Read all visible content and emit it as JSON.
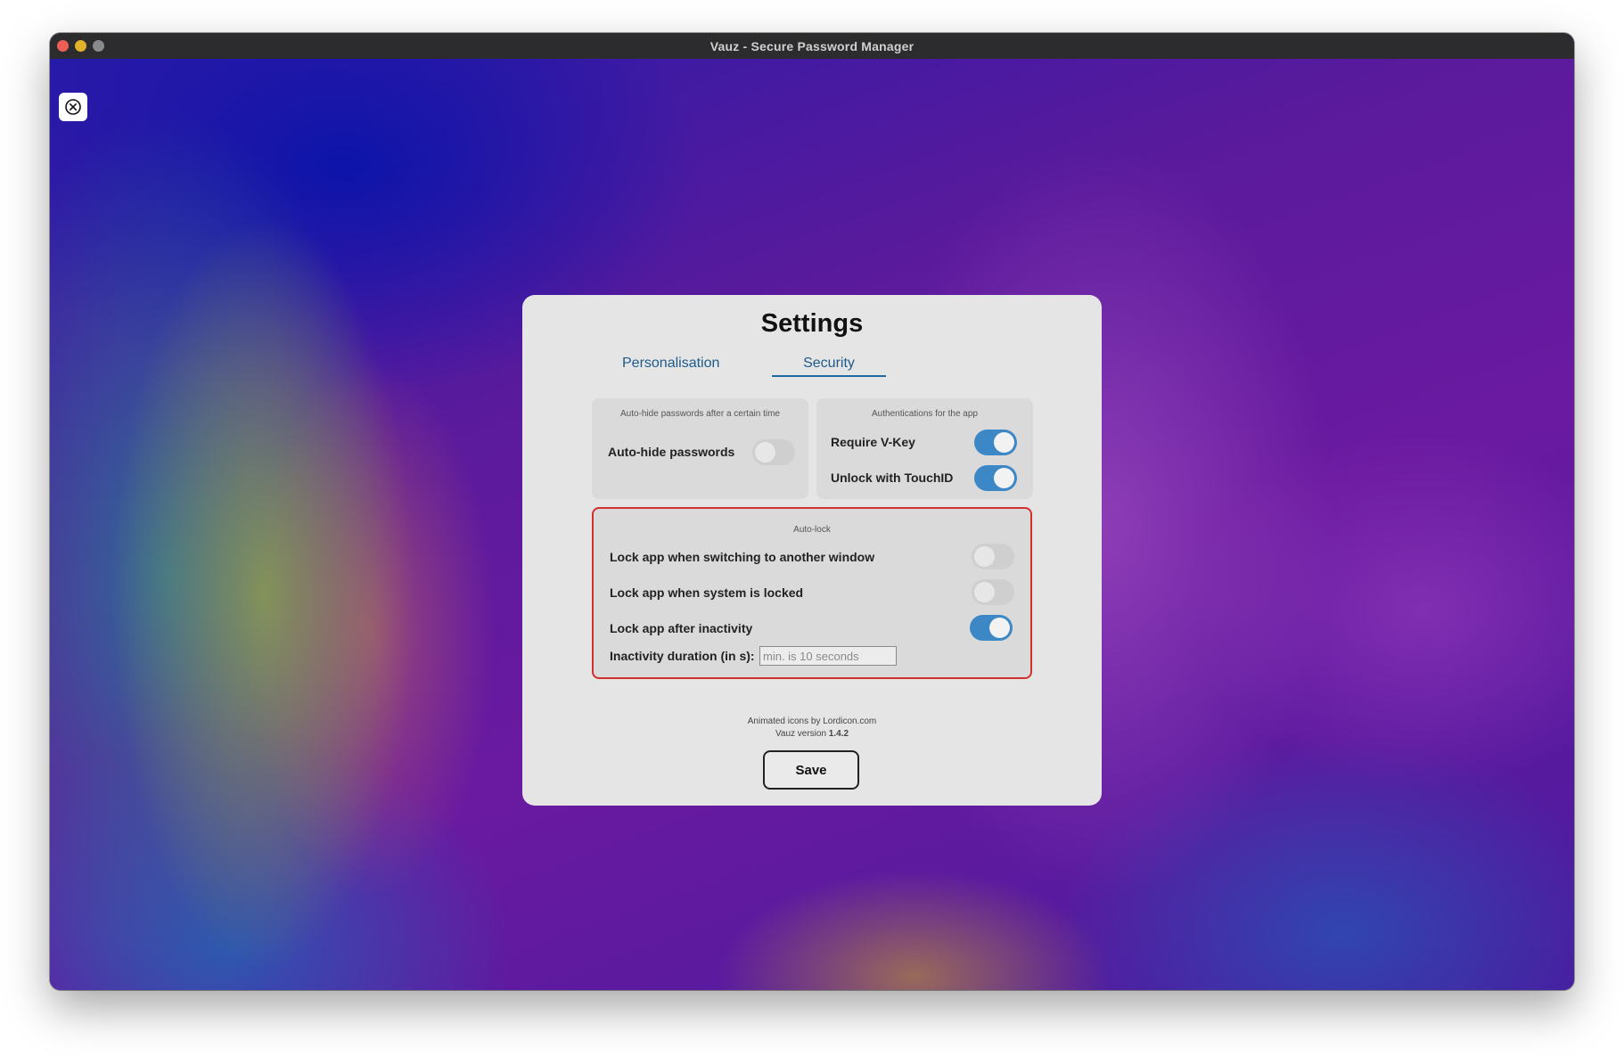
{
  "window": {
    "title": "Vauz - Secure Password Manager"
  },
  "settings": {
    "title": "Settings",
    "tabs": [
      {
        "label": "Personalisation",
        "active": false
      },
      {
        "label": "Security",
        "active": true
      }
    ],
    "autohide_card": {
      "caption": "Auto-hide passwords after a certain time",
      "rows": [
        {
          "label": "Auto-hide passwords",
          "enabled": false
        }
      ]
    },
    "auth_card": {
      "caption": "Authentications for the app",
      "rows": [
        {
          "label": "Require V-Key",
          "enabled": true
        },
        {
          "label": "Unlock with TouchID",
          "enabled": true
        }
      ]
    },
    "autolock": {
      "caption": "Auto-lock",
      "rows": [
        {
          "label": "Lock app when switching to another window",
          "enabled": false
        },
        {
          "label": "Lock app when system is locked",
          "enabled": false
        },
        {
          "label": "Lock app after inactivity",
          "enabled": true
        }
      ],
      "inactivity_label": "Inactivity duration (in s):",
      "inactivity_placeholder": "min. is 10 seconds",
      "inactivity_value": ""
    },
    "credits": {
      "icons": "Animated icons by Lordicon.com",
      "version_prefix": "Vauz version ",
      "version": "1.4.2"
    },
    "save_label": "Save"
  },
  "colors": {
    "accent": "#3c87c5",
    "tab_text": "#1e5a8a",
    "autolock_border": "#d0312d",
    "modal_bg": "#e5e5e5"
  }
}
